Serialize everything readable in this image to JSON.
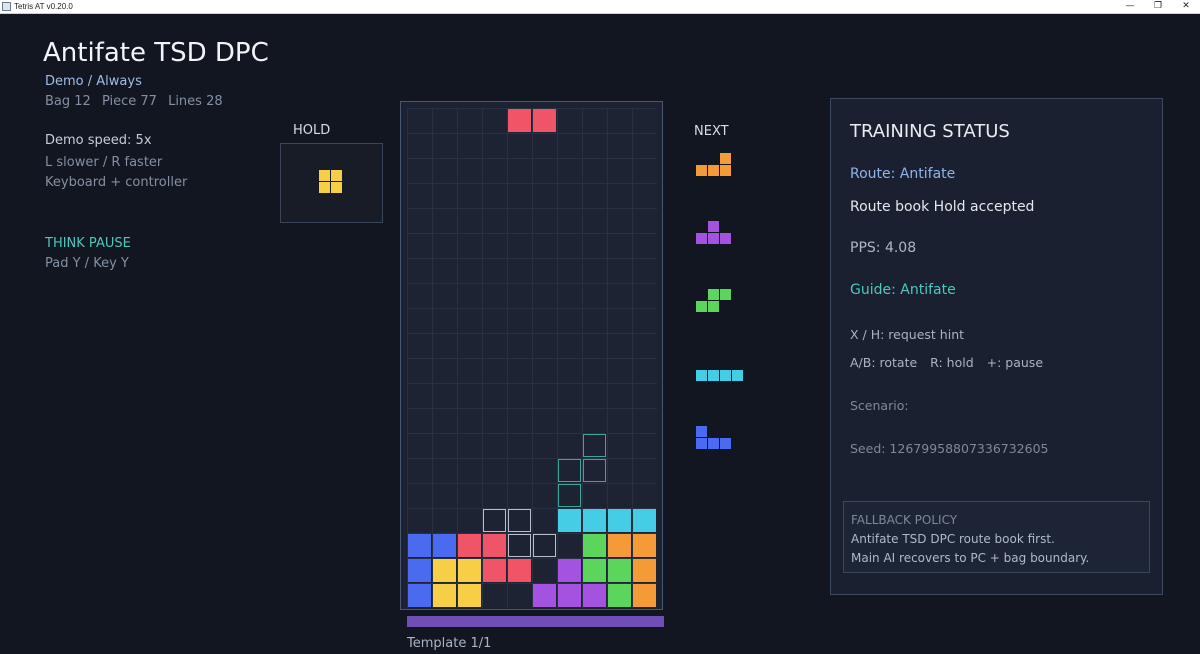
{
  "window": {
    "title": "Tetris AT v0.20.0",
    "minimize": "—",
    "maximize": "❐",
    "close": "✕"
  },
  "header": {
    "title": "Antifate TSD DPC",
    "mode": "Demo / Always",
    "stats": {
      "bag": "Bag 12",
      "piece": "Piece 77",
      "lines": "Lines 28"
    },
    "speed": "Demo speed: 5x",
    "speed_hint": "L slower / R faster",
    "input": "Keyboard + controller",
    "think_pause": "THINK PAUSE",
    "think_pause_keys": "Pad Y / Key Y"
  },
  "hold": {
    "label": "HOLD",
    "piece": "O"
  },
  "next": {
    "label": "NEXT",
    "pieces": [
      "L",
      "T",
      "S",
      "I",
      "J"
    ]
  },
  "board": {
    "cols": 10,
    "rows": 20,
    "template_label": "Template 1/1",
    "template_progress": 1.0,
    "active_piece_cells": [
      [
        4,
        0
      ],
      [
        5,
        0
      ]
    ],
    "locked_cells": [
      {
        "c": 6,
        "r": 16,
        "k": "I"
      },
      {
        "c": 7,
        "r": 16,
        "k": "I"
      },
      {
        "c": 8,
        "r": 16,
        "k": "I"
      },
      {
        "c": 9,
        "r": 16,
        "k": "I"
      },
      {
        "c": 0,
        "r": 17,
        "k": "J"
      },
      {
        "c": 1,
        "r": 17,
        "k": "J"
      },
      {
        "c": 2,
        "r": 17,
        "k": "Z"
      },
      {
        "c": 3,
        "r": 17,
        "k": "Z"
      },
      {
        "c": 7,
        "r": 17,
        "k": "S"
      },
      {
        "c": 8,
        "r": 17,
        "k": "L"
      },
      {
        "c": 9,
        "r": 17,
        "k": "L"
      },
      {
        "c": 0,
        "r": 18,
        "k": "J"
      },
      {
        "c": 1,
        "r": 18,
        "k": "O"
      },
      {
        "c": 2,
        "r": 18,
        "k": "O"
      },
      {
        "c": 3,
        "r": 18,
        "k": "Z"
      },
      {
        "c": 4,
        "r": 18,
        "k": "Z"
      },
      {
        "c": 6,
        "r": 18,
        "k": "T"
      },
      {
        "c": 7,
        "r": 18,
        "k": "S"
      },
      {
        "c": 8,
        "r": 18,
        "k": "S"
      },
      {
        "c": 9,
        "r": 18,
        "k": "L"
      },
      {
        "c": 0,
        "r": 19,
        "k": "J"
      },
      {
        "c": 1,
        "r": 19,
        "k": "O"
      },
      {
        "c": 2,
        "r": 19,
        "k": "O"
      },
      {
        "c": 5,
        "r": 19,
        "k": "T"
      },
      {
        "c": 6,
        "r": 19,
        "k": "T"
      },
      {
        "c": 7,
        "r": 19,
        "k": "T"
      },
      {
        "c": 8,
        "r": 19,
        "k": "S"
      },
      {
        "c": 9,
        "r": 19,
        "k": "L"
      }
    ],
    "ghost_cells": [
      {
        "c": 7,
        "r": 13,
        "k": "teal"
      },
      {
        "c": 6,
        "r": 14,
        "k": "teal"
      },
      {
        "c": 7,
        "r": 14,
        "k": "teal"
      },
      {
        "c": 6,
        "r": 15,
        "k": "teal"
      },
      {
        "c": 3,
        "r": 16,
        "k": "gray"
      },
      {
        "c": 4,
        "r": 16,
        "k": "gray"
      },
      {
        "c": 4,
        "r": 17,
        "k": "gray"
      },
      {
        "c": 5,
        "r": 17,
        "k": "gray"
      }
    ]
  },
  "colors": {
    "I": "#45cde6",
    "O": "#f7cf47",
    "T": "#a452e0",
    "S": "#5cd55c",
    "Z": "#ef5566",
    "J": "#4a6bf0",
    "L": "#f49a36",
    "ghost_teal": "#3aa79a",
    "ghost_gray": "#b9c0cc"
  },
  "status": {
    "title": "TRAINING STATUS",
    "route": "Route: Antifate",
    "route_book": "Route book Hold accepted",
    "pps": "PPS: 4.08",
    "guide": "Guide: Antifate",
    "hint_key": "X / H: request hint",
    "keys": {
      "rotate": "A/B: rotate",
      "hold": "R: hold",
      "pause": "+: pause"
    },
    "scenario": "Scenario:",
    "seed": "Seed: 12679958807336732605",
    "fallback": {
      "title": "FALLBACK POLICY",
      "line1": "Antifate TSD DPC route book first.",
      "line2": "Main AI recovers to PC + bag boundary."
    }
  }
}
